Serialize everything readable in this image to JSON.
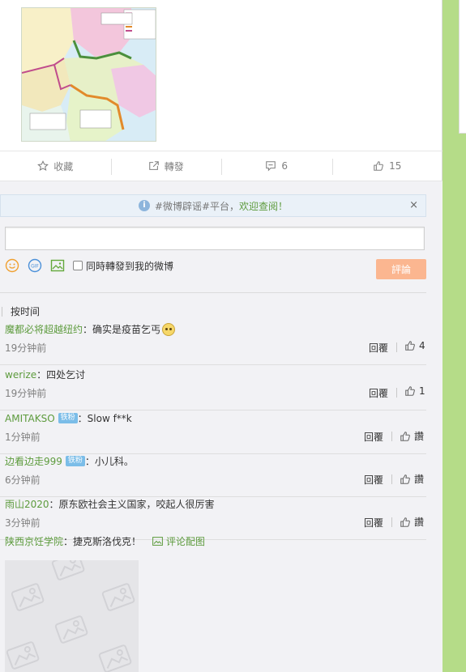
{
  "actions": [
    {
      "name": "favorite",
      "icon": "star-icon",
      "label": "收藏"
    },
    {
      "name": "forward",
      "icon": "forward-icon",
      "label": "轉發"
    },
    {
      "name": "comment",
      "icon": "comment-icon",
      "label": "6"
    },
    {
      "name": "like",
      "icon": "thumbs-up-icon",
      "label": "15"
    }
  ],
  "notice": {
    "prefix": "#微博辟谣#平台，",
    "link": "欢迎查阅！",
    "close": "×"
  },
  "composer": {
    "placeholder": "",
    "forward_label": "同時轉發到我的微博",
    "submit_label": "評論",
    "tools": [
      "emoji-icon",
      "gif-icon",
      "image-icon"
    ]
  },
  "sort": {
    "label": "按时间"
  },
  "comments": [
    {
      "user": "魔都必将超越纽约",
      "badge": "",
      "text": "：确实是疫苗乞丐",
      "emoji": true,
      "time": "19分钟前",
      "reply": "回覆",
      "likes": "4"
    },
    {
      "user": "werize",
      "badge": "",
      "text": "：四处乞讨",
      "emoji": false,
      "time": "19分钟前",
      "reply": "回覆",
      "likes": "1"
    },
    {
      "user": "AMITAKSO",
      "badge": "铁粉",
      "text": "：Slow f**k",
      "emoji": false,
      "time": "1分钟前",
      "reply": "回覆",
      "likes": "讚"
    },
    {
      "user": "边看边走999",
      "badge": "铁粉",
      "text": "：小儿科。",
      "emoji": false,
      "time": "6分钟前",
      "reply": "回覆",
      "likes": "讚"
    },
    {
      "user": "雨山2020",
      "badge": "",
      "text": "：原东欧社会主义国家，咬起人很厉害",
      "emoji": false,
      "time": "3分钟前",
      "reply": "回覆",
      "likes": "讚"
    }
  ],
  "pic_comment": {
    "user": "陕西京饪学院",
    "text": "：捷克斯洛伐克！",
    "link": "评论配图"
  },
  "colors": {
    "accent_green": "#5d9b3d",
    "submit_bg": "#fbb690",
    "sidebar_green": "#b5dc88"
  }
}
